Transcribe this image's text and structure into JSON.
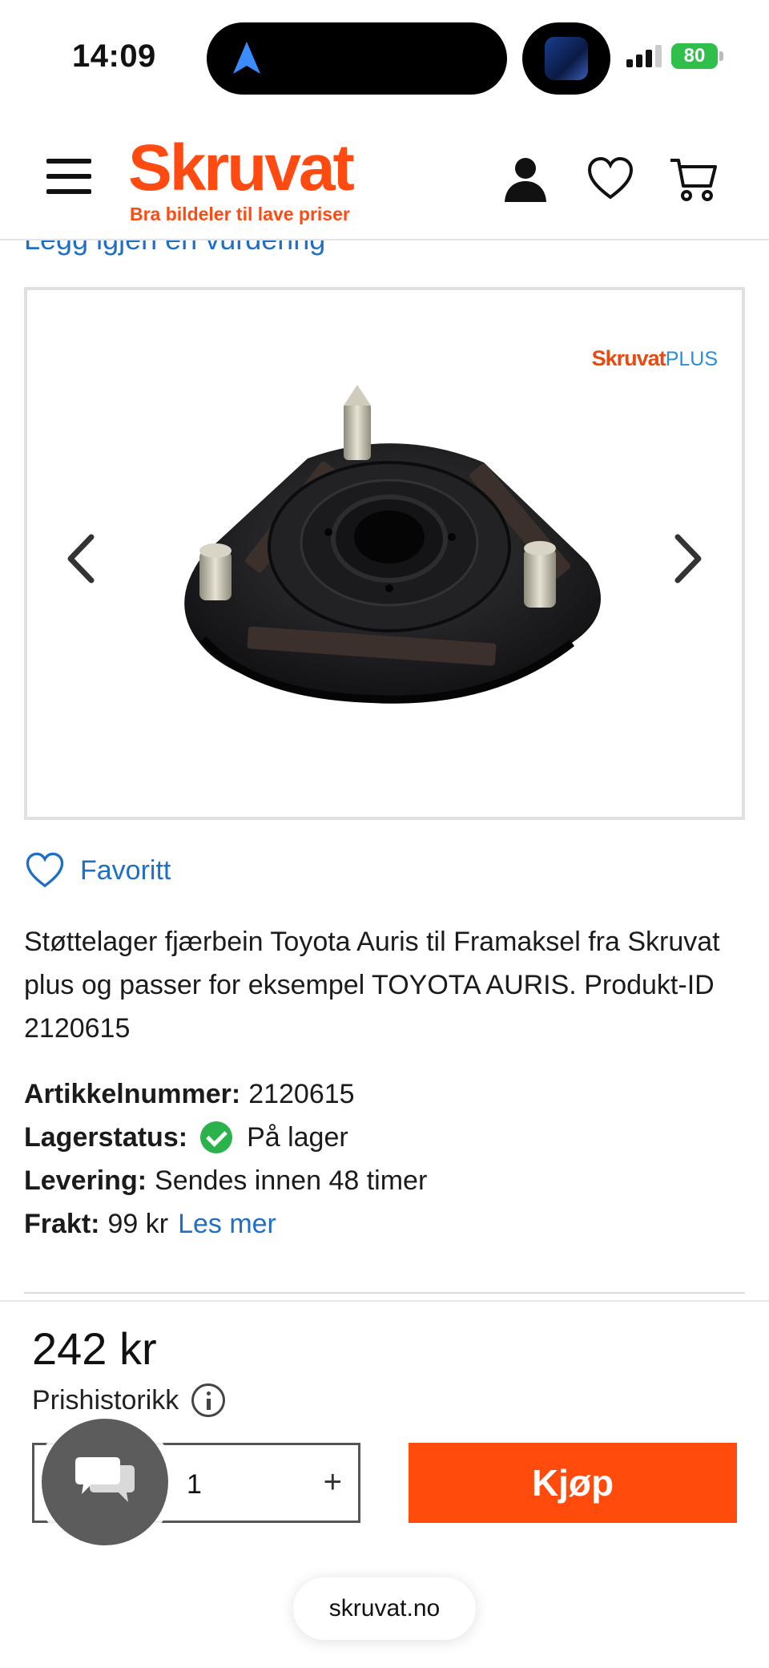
{
  "status_bar": {
    "time": "14:09",
    "battery": "80"
  },
  "header": {
    "logo_text": "Skruvat",
    "logo_tagline": "Bra bildeler til lave priser",
    "accent_color": "#ff4b12",
    "icons": [
      "menu-icon",
      "account-icon",
      "wishlist-icon",
      "cart-icon"
    ]
  },
  "review_link": "Legg igjen en vurdering",
  "gallery": {
    "brand_badge_main": "Skruvat",
    "brand_badge_plus": "PLUS",
    "prev_icon": "chevron-left-icon",
    "next_icon": "chevron-right-icon"
  },
  "favorite": {
    "label": "Favoritt"
  },
  "description": "Støttelager fjærbein Toyota Auris til Framaksel fra Skruvat plus og passer for eksempel TOYOTA AURIS. Produkt-ID 2120615",
  "specs": {
    "article_label": "Artikkelnummer:",
    "article_value": "2120615",
    "stock_label": "Lagerstatus:",
    "stock_value": "På lager",
    "delivery_label": "Levering:",
    "delivery_value": "Sendes innen 48 timer",
    "freight_label": "Frakt:",
    "freight_value": "99 kr",
    "freight_link": "Les mer"
  },
  "purchase": {
    "price": "242 kr",
    "price_history": "Prishistorikk",
    "quantity": "1",
    "plus": "+",
    "buy_label": "Kjøp"
  },
  "browser": {
    "url": "skruvat.no"
  }
}
